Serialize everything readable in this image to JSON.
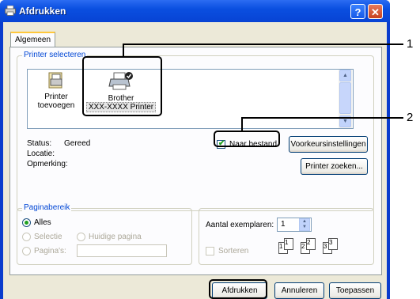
{
  "window": {
    "title": "Afdrukken",
    "help_glyph": "?",
    "close_glyph": "✕"
  },
  "tab": {
    "label": "Algemeen"
  },
  "printer_select": {
    "legend": "Printer selecteren",
    "items": [
      {
        "label_line1": "Printer",
        "label_line2": "toevoegen",
        "icon": "add-printer-icon"
      },
      {
        "label_line1": "Brother",
        "label_line2": "XXX-XXXX  Printer",
        "icon": "printer-icon",
        "selected": true
      }
    ]
  },
  "status": {
    "status_label": "Status:",
    "status_value": "Gereed",
    "location_label": "Locatie:",
    "comment_label": "Opmerking:"
  },
  "print_to_file": {
    "label": "Naar bestand",
    "checked": true
  },
  "buttons": {
    "preferences": "Voorkeursinstellingen",
    "find_printer": "Printer zoeken...",
    "print": "Afdrukken",
    "cancel": "Annuleren",
    "apply": "Toepassen"
  },
  "page_range": {
    "legend": "Paginabereik",
    "all": "Alles",
    "selection": "Selectie",
    "current_page": "Huidige pagina",
    "pages": "Pagina's:"
  },
  "copies": {
    "label": "Aantal exemplaren:",
    "value": "1",
    "collate": "Sorteren",
    "pages": [
      "1",
      "1",
      "2",
      "2",
      "3",
      "3"
    ]
  },
  "callouts": [
    "1",
    "2"
  ]
}
